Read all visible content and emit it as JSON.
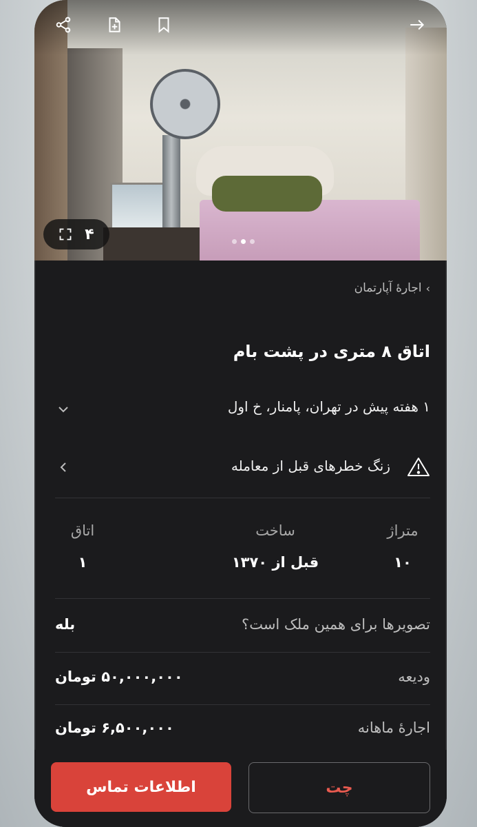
{
  "breadcrumb": "اجارهٔ آپارتمان",
  "listing": {
    "title": "اتاق ۸ متری در پشت بام",
    "subtitle": "۱ هفته پیش در تهران، پامنار، خ اول",
    "warning": "زنگ خطرهای قبل از معامله"
  },
  "gallery": {
    "count": "۴",
    "total_dots": 3,
    "active_dot": 1
  },
  "stats": [
    {
      "label": "متراژ",
      "value": "۱۰"
    },
    {
      "label": "ساخت",
      "value": "قبل از ۱۳۷۰"
    },
    {
      "label": "اتاق",
      "value": "۱"
    }
  ],
  "details": [
    {
      "key": "تصویرها برای همین ملک است؟",
      "value": "بله"
    },
    {
      "key": "ودیعه",
      "value": "۵۰,۰۰۰,۰۰۰ تومان"
    },
    {
      "key": "اجارهٔ ماهانه",
      "value": "۶,۵۰۰,۰۰۰ تومان"
    }
  ],
  "actions": {
    "chat": "چت",
    "contact": "اطلاعات تماس"
  },
  "colors": {
    "accent": "#d9433a",
    "background": "#1b1b1d"
  },
  "icons": [
    "share-icon",
    "add-note-icon",
    "bookmark-icon",
    "back-arrow-icon",
    "fullscreen-icon",
    "warning-icon",
    "chevron-down-icon",
    "chevron-left-icon"
  ]
}
